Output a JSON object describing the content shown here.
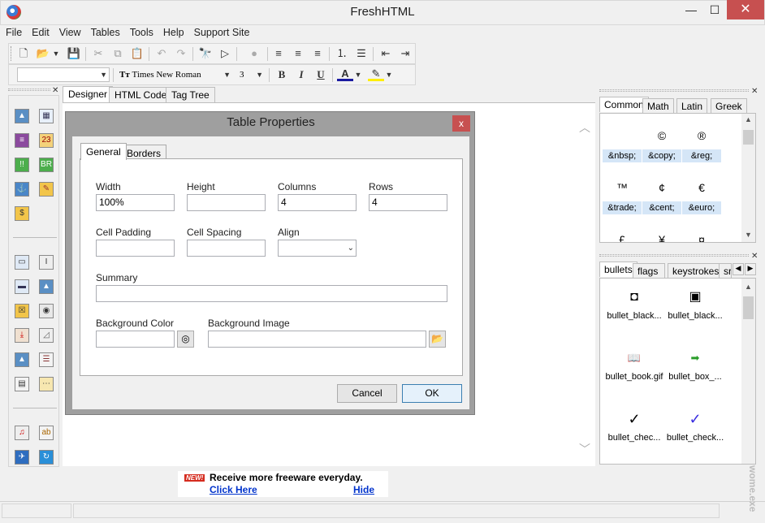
{
  "window": {
    "title": "FreshHTML",
    "minimize_glyph": "—",
    "maximize_glyph": "☐",
    "close_glyph": "✕"
  },
  "menu": [
    "File",
    "Edit",
    "View",
    "Tables",
    "Tools",
    "Help",
    "Support Site"
  ],
  "toolbar": {
    "font_name": "Times New Roman",
    "font_size": "3",
    "bold": "B",
    "italic": "I",
    "underline": "U",
    "font_color_glyph": "A"
  },
  "main_tabs": [
    "Designer",
    "HTML Code",
    "Tag Tree"
  ],
  "dialog": {
    "title": "Table Properties",
    "close_glyph": "x",
    "tabs": [
      "General",
      "Borders"
    ],
    "labels": {
      "width": "Width",
      "height": "Height",
      "columns": "Columns",
      "rows": "Rows",
      "cell_padding": "Cell Padding",
      "cell_spacing": "Cell Spacing",
      "align": "Align",
      "summary": "Summary",
      "background_color": "Background Color",
      "background_image": "Background Image"
    },
    "values": {
      "width": "100%",
      "height": "",
      "columns": "4",
      "rows": "4",
      "cell_padding": "",
      "cell_spacing": "",
      "align": "",
      "summary": "",
      "background_color": "",
      "background_image": ""
    },
    "buttons": {
      "cancel": "Cancel",
      "ok": "OK"
    }
  },
  "entities_panel": {
    "tabs": [
      "Common",
      "Math",
      "Latin",
      "Greek"
    ],
    "items": [
      {
        "symbol": "",
        "code": "&nbsp;"
      },
      {
        "symbol": "©",
        "code": "&copy;"
      },
      {
        "symbol": "®",
        "code": "&reg;"
      },
      {
        "symbol": "™",
        "code": "&trade;"
      },
      {
        "symbol": "¢",
        "code": "&cent;"
      },
      {
        "symbol": "€",
        "code": "&euro;"
      },
      {
        "symbol": "£",
        "code": ""
      },
      {
        "symbol": "¥",
        "code": ""
      },
      {
        "symbol": "¤",
        "code": ""
      }
    ]
  },
  "images_panel": {
    "tabs": [
      "bullets",
      "flags",
      "keystrokes",
      "sr"
    ],
    "items": [
      {
        "glyph": "◘",
        "label": "bullet_black..."
      },
      {
        "glyph": "▣",
        "label": "bullet_black..."
      },
      {
        "glyph": "📖",
        "label": "bullet_book.gif"
      },
      {
        "glyph": "➡",
        "label": "bullet_box_..."
      },
      {
        "glyph": "✓",
        "label": "bullet_chec..."
      },
      {
        "glyph": "✓",
        "label": "bullet_check..."
      }
    ]
  },
  "ad": {
    "badge": "NEW!",
    "text": "Receive more freeware everyday.",
    "link": "Click Here",
    "hide": "Hide"
  },
  "watermark": "wome.exe",
  "colors": {
    "accent_close": "#c75050",
    "link": "#0033cc",
    "entity_code_bg": "#d5e6f7",
    "ok_border": "#3c7fb1"
  }
}
